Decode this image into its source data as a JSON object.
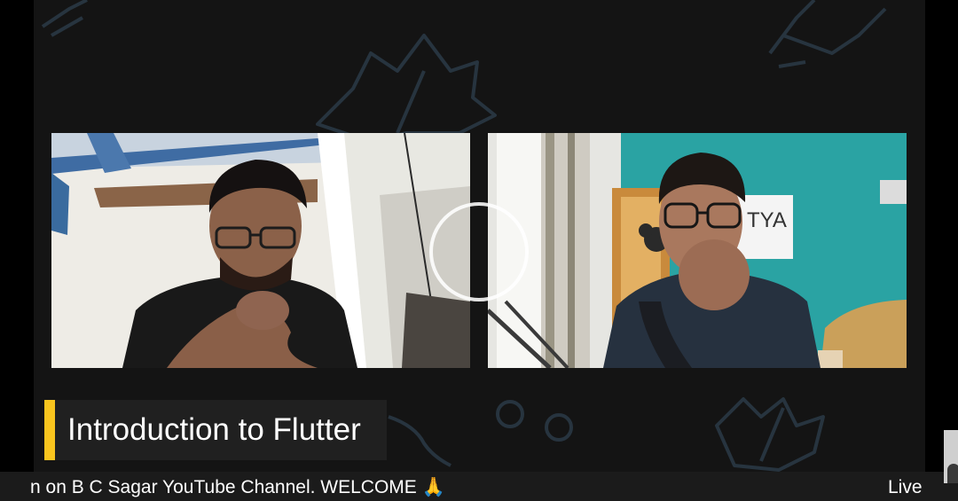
{
  "colors": {
    "canvas_bg": "#141414",
    "title_accent": "#f9c51e",
    "title_bar_bg": "#202020",
    "ticker_bg": "#1b1b1b",
    "leaf_outline": "#2b3946"
  },
  "stream": {
    "title": "Introduction to Flutter",
    "ticker": "n on B C Sagar YouTube Channel. WELCOME 🙏",
    "live_label": "Live"
  },
  "participants": [
    {
      "position": "left",
      "description_icon": "participant-video-icon"
    },
    {
      "position": "right",
      "description_icon": "participant-video-icon",
      "wall_sign_text": "TYA"
    }
  ],
  "loading_indicator": "spinner-icon"
}
